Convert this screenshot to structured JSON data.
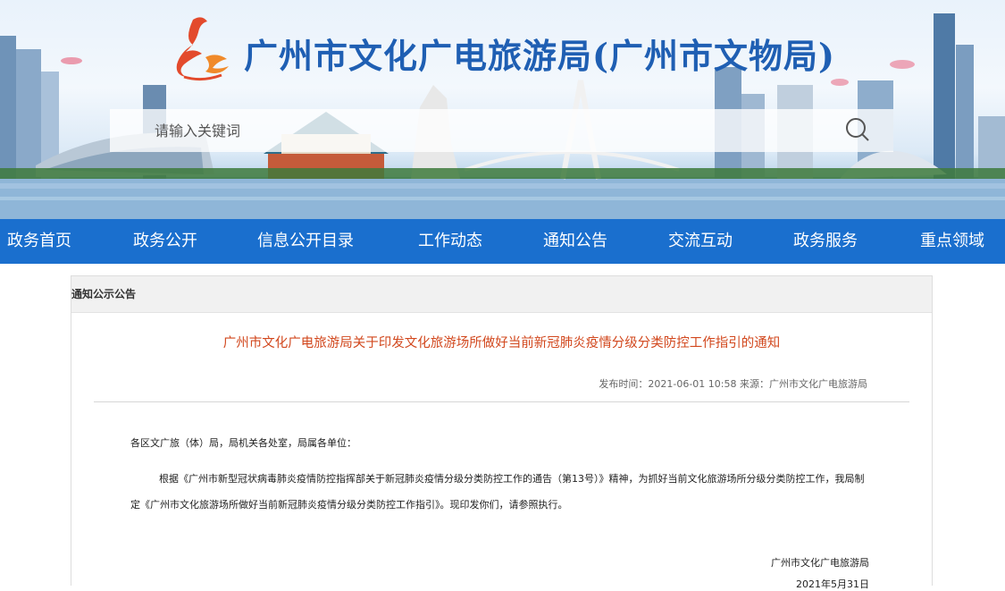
{
  "header": {
    "site_title": "广州市文化广电旅游局(广州市文物局)",
    "search": {
      "placeholder": "请输入关键词",
      "value": ""
    },
    "colors": {
      "title": "#1f5fb3",
      "nav_bg": "#1a6fce",
      "article_title": "#d2481e"
    }
  },
  "nav": {
    "items": [
      {
        "label": "政务首页"
      },
      {
        "label": "政务公开"
      },
      {
        "label": "信息公开目录"
      },
      {
        "label": "工作动态"
      },
      {
        "label": "通知公告"
      },
      {
        "label": "交流互动"
      },
      {
        "label": "政务服务"
      },
      {
        "label": "重点领域"
      }
    ]
  },
  "section": {
    "heading": "通知公示公告"
  },
  "article": {
    "title": "广州市文化广电旅游局关于印发文化旅游场所做好当前新冠肺炎疫情分级分类防控工作指引的通知",
    "meta": "发布时间：2021-06-01 10:58 来源：广州市文化广电旅游局",
    "salutation": "各区文广旅（体）局，局机关各处室，局属各单位：",
    "paragraph": "根据《广州市新型冠状病毒肺炎疫情防控指挥部关于新冠肺炎疫情分级分类防控工作的通告（第13号）》精神，为抓好当前文化旅游场所分级分类防控工作，我局制定《广州市文化旅游场所做好当前新冠肺炎疫情分级分类防控工作指引》。现印发你们，请参照执行。",
    "signature": "广州市文化广电旅游局",
    "date": "2021年5月31日"
  }
}
